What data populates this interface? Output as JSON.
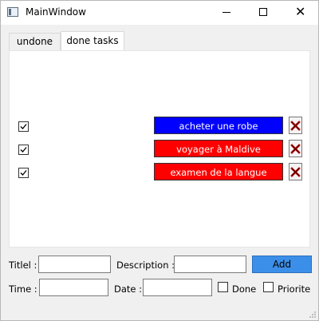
{
  "window": {
    "title": "MainWindow"
  },
  "tabs": [
    {
      "label": "undone",
      "active": false
    },
    {
      "label": "done tasks",
      "active": true
    }
  ],
  "tasks": [
    {
      "title": "acheter une robe",
      "done": true,
      "color": "#0000ff"
    },
    {
      "title": "voyager à Maldive",
      "done": true,
      "color": "#ff0000"
    },
    {
      "title": "examen de la langue",
      "done": true,
      "color": "#ff0000"
    }
  ],
  "form": {
    "title_label": "Titlel :",
    "title_value": "",
    "description_label": "Description :",
    "description_value": "",
    "add_label": "Add",
    "time_label": "Time :",
    "time_value": "",
    "date_label": "Date :",
    "date_value": "",
    "done_label": "Done",
    "done_checked": false,
    "priorite_label": "Priorite",
    "priorite_checked": false
  },
  "colors": {
    "accent": "#3c8fe8",
    "delete_icon": "#c00000"
  },
  "icons": {
    "app": "window-icon",
    "delete": "red-x-icon",
    "check": "checkmark-icon"
  }
}
